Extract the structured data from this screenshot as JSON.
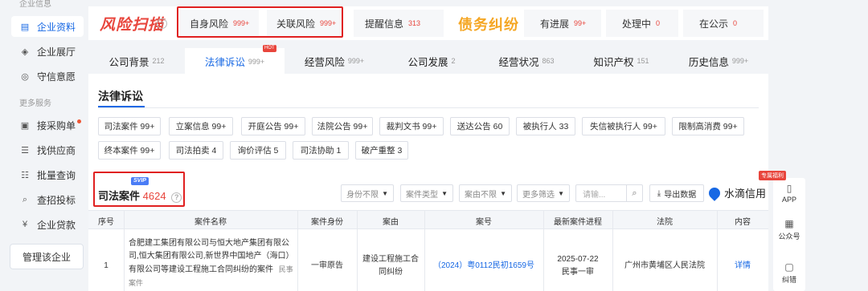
{
  "sidebar": {
    "top_section": "企业信息",
    "items": [
      {
        "label": "企业资料",
        "icon": "document-icon"
      },
      {
        "label": "企业展厅",
        "icon": "layers-icon"
      },
      {
        "label": "守信意愿",
        "icon": "target-icon"
      }
    ],
    "more_section": "更多服务",
    "more_items": [
      {
        "label": "接采购单",
        "icon": "cart-icon"
      },
      {
        "label": "找供应商",
        "icon": "list-icon"
      },
      {
        "label": "批量查询",
        "icon": "batch-icon"
      },
      {
        "label": "查招投标",
        "icon": "search-icon"
      },
      {
        "label": "企业贷款",
        "icon": "loan-icon"
      }
    ],
    "manage_button": "管理该企业"
  },
  "risk": {
    "logo": "风险扫描",
    "items": [
      {
        "label": "自身风险",
        "count": "999+"
      },
      {
        "label": "关联风险",
        "count": "999+"
      },
      {
        "label": "提醒信息",
        "count": "313"
      }
    ],
    "debt_logo": "债务纠纷",
    "debt_items": [
      {
        "label": "有进展",
        "count": "99+"
      },
      {
        "label": "处理中",
        "count": "0"
      },
      {
        "label": "在公示",
        "count": "0"
      }
    ]
  },
  "tabs": [
    {
      "label": "公司背景",
      "count": "212"
    },
    {
      "label": "法律诉讼",
      "count": "999+",
      "badge": "HOT"
    },
    {
      "label": "经营风险",
      "count": "999+"
    },
    {
      "label": "公司发展",
      "count": "2"
    },
    {
      "label": "经营状况",
      "count": "863"
    },
    {
      "label": "知识产权",
      "count": "151"
    },
    {
      "label": "历史信息",
      "count": "999+"
    }
  ],
  "panel": {
    "title": "法律诉讼",
    "chips_row1": [
      "司法案件 99+",
      "立案信息 99+",
      "开庭公告 99+",
      "法院公告 99+",
      "裁判文书 99+",
      "送达公告 60",
      "被执行人 33",
      "失信被执行人 99+",
      "限制高消费 99+"
    ],
    "chips_row2": [
      "终本案件 99+",
      "司法拍卖 4",
      "询价评估 5",
      "司法协助 1",
      "破产重整 3"
    ],
    "section_title": "司法案件",
    "section_count": "4624",
    "svip": "SVIP",
    "filters": [
      "身份不限",
      "案件类型",
      "案由不限",
      "更多筛选"
    ],
    "search_placeholder": "请输...",
    "export_label": "导出数据",
    "brand": "水滴信用"
  },
  "table": {
    "headers": [
      "序号",
      "案件名称",
      "案件身份",
      "案由",
      "案号",
      "最新案件进程",
      "法院",
      "内容"
    ],
    "row": {
      "index": "1",
      "name": "合肥建工集团有限公司与恒大地产集团有限公司,恒大集团有限公司,新世界中国地产（海口）有限公司等建设工程施工合同纠纷的案件",
      "tag": "民事案件",
      "identity": "一审原告",
      "cause": "建设工程施工合同纠纷",
      "case_no": "（2024）粤0112民初1659号",
      "progress_date": "2025-07-22",
      "progress_stage": "民事一审",
      "court": "广州市黄埔区人民法院",
      "detail": "详情"
    }
  },
  "rail": {
    "gift": "专属福利",
    "items": [
      {
        "label": "APP",
        "icon": "phone-icon"
      },
      {
        "label": "公众号",
        "icon": "qrcode-icon"
      },
      {
        "label": "纠错",
        "icon": "feedback-icon"
      }
    ]
  },
  "colors": {
    "accent": "#1768e4",
    "risk": "#e8453c",
    "debt": "#f5a623",
    "highlight_box": "#e02020"
  }
}
